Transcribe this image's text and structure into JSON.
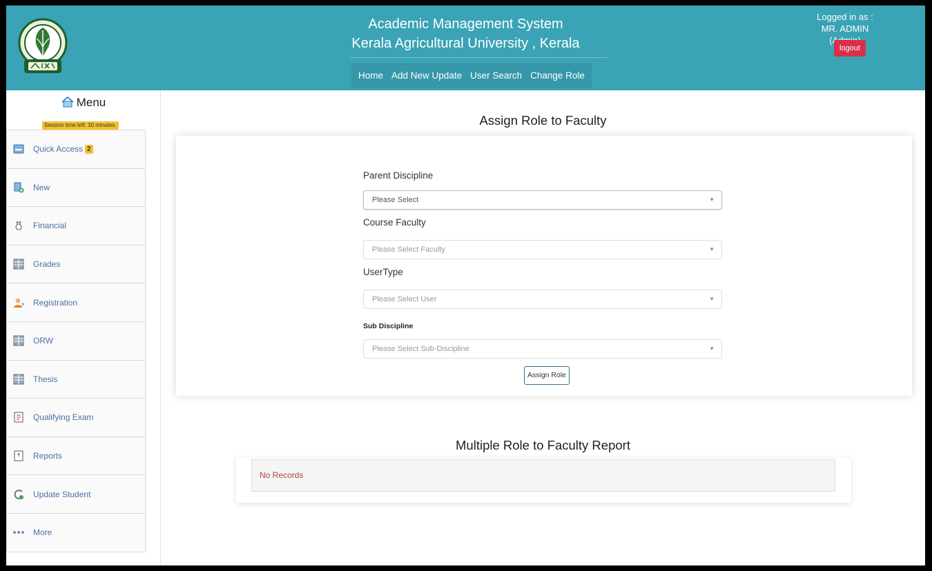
{
  "header": {
    "title_line1": "Academic Management System",
    "title_line2": "Kerala Agricultural University , Kerala",
    "logo_icon": "university-seal-icon",
    "nav": [
      "Home",
      "Add New Update",
      "User Search",
      "Change Role"
    ],
    "logged_in_label": "Logged in as :",
    "user_name": "MR. ADMIN (Admin)",
    "logout_label": "logout"
  },
  "sidebar": {
    "menu_title": "Menu",
    "session_text": "Session time left: 30 minutes.",
    "items": [
      {
        "label": "Quick Access",
        "badge": "2",
        "icon": "quick-access-icon"
      },
      {
        "label": "New",
        "icon": "new-icon"
      },
      {
        "label": "Financial",
        "icon": "financial-icon"
      },
      {
        "label": "Grades",
        "icon": "grades-icon"
      },
      {
        "label": "Registration",
        "icon": "registration-icon"
      },
      {
        "label": "ORW",
        "icon": "orw-icon"
      },
      {
        "label": "Thesis",
        "icon": "thesis-icon"
      },
      {
        "label": "Qualifying Exam",
        "icon": "qualifying-exam-icon"
      },
      {
        "label": "Reports",
        "icon": "reports-icon"
      },
      {
        "label": "Update Student",
        "icon": "update-student-icon"
      },
      {
        "label": "More",
        "icon": "more-icon"
      }
    ]
  },
  "form": {
    "title": "Assign Role to Faculty",
    "parent_discipline_label": "Parent Discipline",
    "parent_discipline_value": "Please Select",
    "course_faculty_label": "Course Faculty",
    "course_faculty_value": "Please Select Faculty",
    "user_type_label": "UserType",
    "user_type_value": "Please Select User",
    "sub_discipline_label": "Sub Discipline",
    "sub_discipline_value": "Please Select Sub-Discipline",
    "assign_button": "Assign Role"
  },
  "report": {
    "title": "Multiple Role to Faculty Report",
    "empty_text": "No Records"
  },
  "colors": {
    "header_bg": "#3aa3b6",
    "logout_bg": "#d9304a",
    "badge_bg": "#f2c12e",
    "link": "#4a6fa5",
    "no_records": "#a94442"
  }
}
